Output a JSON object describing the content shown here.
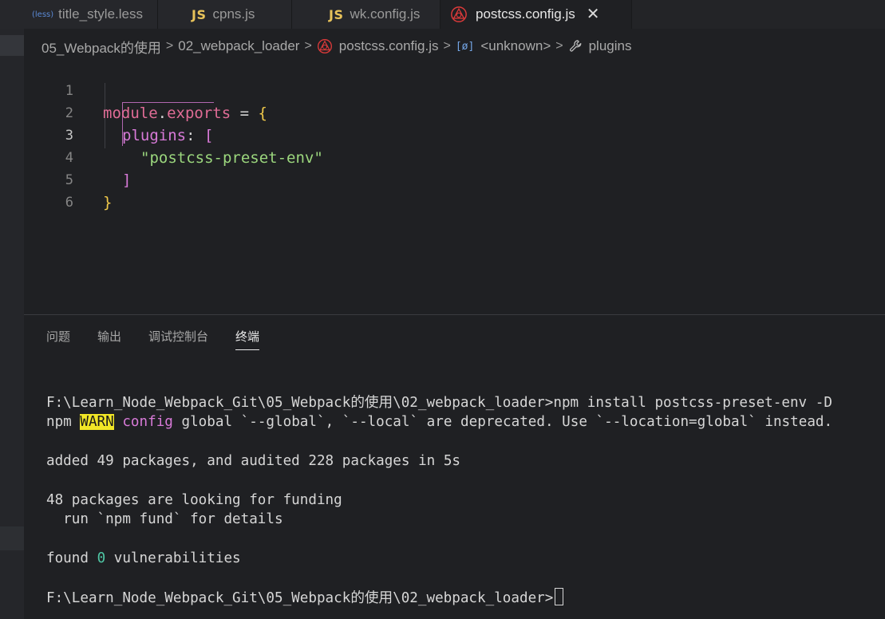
{
  "tabs": [
    {
      "icon": "(less)",
      "label": "title_style.less"
    },
    {
      "icon": "JS",
      "label": "cpns.js"
    },
    {
      "icon": "JS",
      "label": "wk.config.js"
    },
    {
      "icon": "postcss",
      "label": "postcss.config.js",
      "active": true
    }
  ],
  "tab_close_glyph": "✕",
  "breadcrumb": {
    "items": [
      "05_Webpack的使用",
      "02_webpack_loader",
      "postcss.config.js",
      "<unknown>",
      "plugins"
    ],
    "separator": ">",
    "object_icon": "[ø]"
  },
  "editor": {
    "line_numbers": [
      "1",
      "2",
      "3",
      "4",
      "5",
      "6"
    ],
    "current_line": "3",
    "code": {
      "l1_module": "module",
      "l1_dot": ".",
      "l1_exports": "exports",
      "l1_eq": " = ",
      "l1_brace": "{",
      "l2_key": "plugins",
      "l2_colon": ": ",
      "l2_bracket": "[",
      "l3_string": "\"postcss-preset-env\"",
      "l4_bracket": "]",
      "l5_brace": "}"
    }
  },
  "panel": {
    "tabs": [
      "问题",
      "输出",
      "调试控制台",
      "终端"
    ],
    "active_tab": "终端"
  },
  "terminal": {
    "line1": "F:\\Learn_Node_Webpack_Git\\05_Webpack的使用\\02_webpack_loader>npm install postcss-preset-env -D",
    "line2_npm": "npm ",
    "line2_warn": "WARN",
    "line2_config": "config",
    "line2_rest": " global `--global`, `--local` are deprecated. Use `--location=global` instead.",
    "line3": "added 49 packages, and audited 228 packages in 5s",
    "line4": "48 packages are looking for funding",
    "line5": "  run `npm fund` for details",
    "line6_pre": "found ",
    "line6_zero": "0",
    "line6_post": " vulnerabilities",
    "line7": "F:\\Learn_Node_Webpack_Git\\05_Webpack的使用\\02_webpack_loader>"
  },
  "colors": {
    "background": "#1f2023",
    "keyword": "#e06c96",
    "string": "#9bd67d",
    "bracket": "#d87ad8",
    "brace": "#f0c94a",
    "warn_bg": "#f1e626",
    "zero": "#4fc6a4"
  }
}
